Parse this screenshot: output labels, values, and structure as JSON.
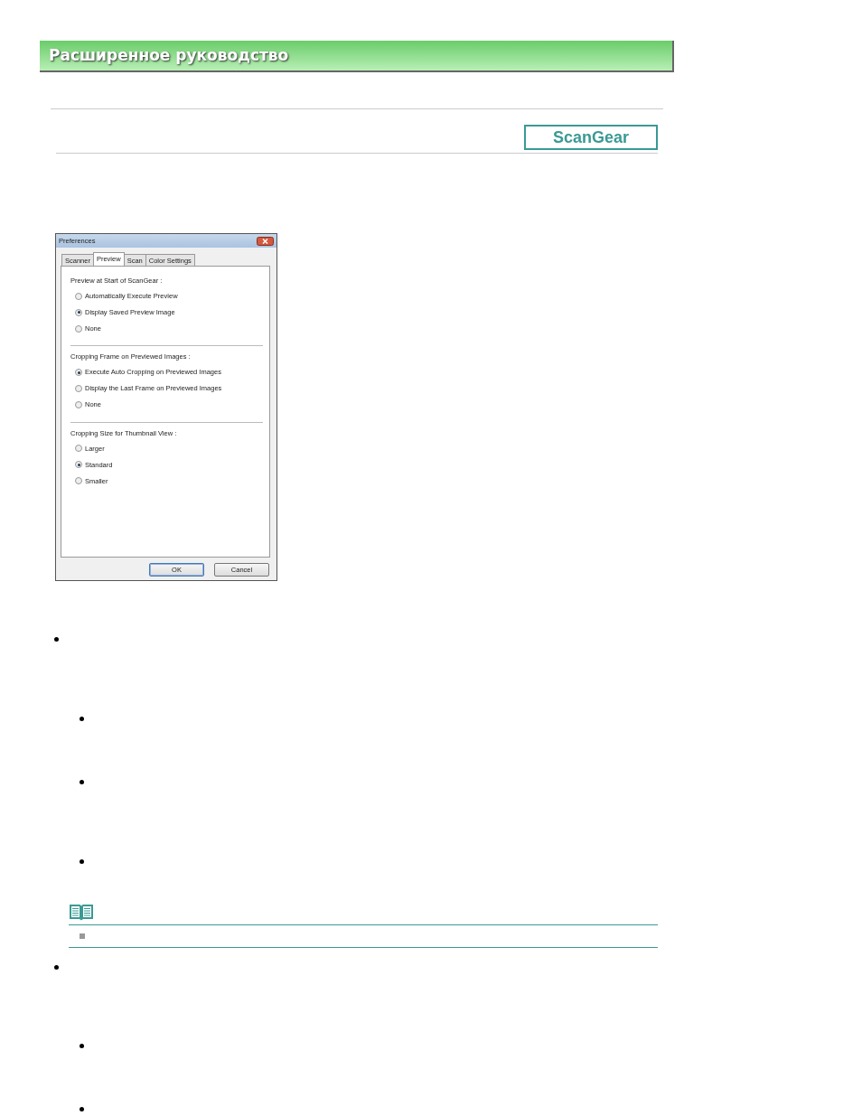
{
  "header": {
    "title": "Расширенное руководство"
  },
  "product_badge": "ScanGear",
  "dialog": {
    "title": "Preferences",
    "tabs": [
      {
        "label": "Scanner",
        "selected": false
      },
      {
        "label": "Preview",
        "selected": true
      },
      {
        "label": "Scan",
        "selected": false
      },
      {
        "label": "Color Settings",
        "selected": false
      }
    ],
    "groups": [
      {
        "label": "Preview at Start of ScanGear :",
        "options": [
          {
            "label": "Automatically Execute Preview",
            "selected": false
          },
          {
            "label": "Display Saved Preview Image",
            "selected": true
          },
          {
            "label": "None",
            "selected": false
          }
        ]
      },
      {
        "label": "Cropping Frame on Previewed Images :",
        "options": [
          {
            "label": "Execute Auto Cropping on Previewed Images",
            "selected": true
          },
          {
            "label": "Display the Last Frame on Previewed Images",
            "selected": false
          },
          {
            "label": "None",
            "selected": false
          }
        ]
      },
      {
        "label": "Cropping Size for Thumbnail View :",
        "options": [
          {
            "label": "Larger",
            "selected": false
          },
          {
            "label": "Standard",
            "selected": true
          },
          {
            "label": "Smaller",
            "selected": false
          }
        ]
      }
    ],
    "buttons": [
      {
        "label": "OK",
        "kind": "default"
      },
      {
        "label": "Cancel",
        "kind": "normal"
      }
    ]
  }
}
